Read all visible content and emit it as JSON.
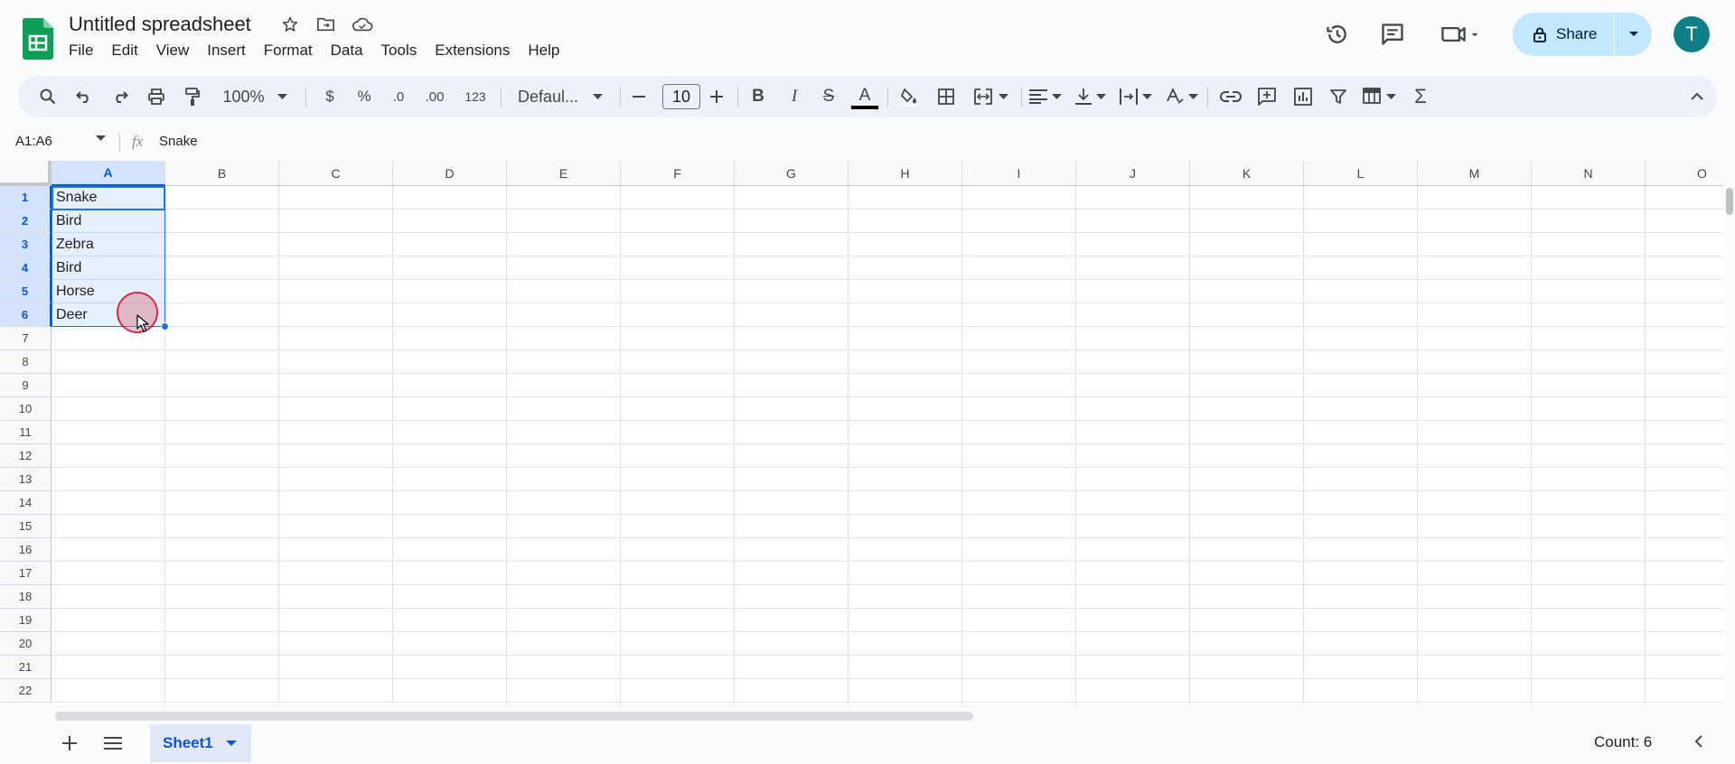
{
  "doc": {
    "title": "Untitled spreadsheet"
  },
  "menu": [
    "File",
    "Edit",
    "View",
    "Insert",
    "Format",
    "Data",
    "Tools",
    "Extensions",
    "Help"
  ],
  "share": {
    "label": "Share"
  },
  "avatar": {
    "initial": "T",
    "color": "#0f7f88"
  },
  "toolbar": {
    "zoom": "100%",
    "currency": "$",
    "percent": "%",
    "decrease_decimal": ".0",
    "increase_decimal": ".00",
    "number_format": "123",
    "font": "Defaul...",
    "font_size": "10",
    "bold": "B",
    "italic": "I",
    "strikethrough": "S",
    "text_color": "A",
    "sum": "Σ"
  },
  "formula_bar": {
    "name_box": "A1:A6",
    "fx": "fx",
    "content": "Snake"
  },
  "grid": {
    "columns": [
      "A",
      "B",
      "C",
      "D",
      "E",
      "F",
      "G",
      "H",
      "I",
      "J",
      "K",
      "L",
      "M",
      "N",
      "O"
    ],
    "rows": [
      "1",
      "2",
      "3",
      "4",
      "5",
      "6",
      "7",
      "8",
      "9",
      "10",
      "11",
      "12",
      "13",
      "14",
      "15",
      "16",
      "17",
      "18",
      "19",
      "20",
      "21",
      "22"
    ],
    "cells_A": [
      "Snake",
      "Bird",
      "Zebra",
      "Bird",
      "Horse",
      "Deer"
    ],
    "selected_range": "A1:A6"
  },
  "bottom": {
    "sheet_tab": "Sheet1",
    "status": "Count: 6"
  },
  "colors": {
    "accent": "#0b57d0",
    "share_bg": "#c2e7ff",
    "toolbar_bg": "#edf2fa",
    "selection": "#1a73e8",
    "sheets_green": "#0f9d58"
  }
}
